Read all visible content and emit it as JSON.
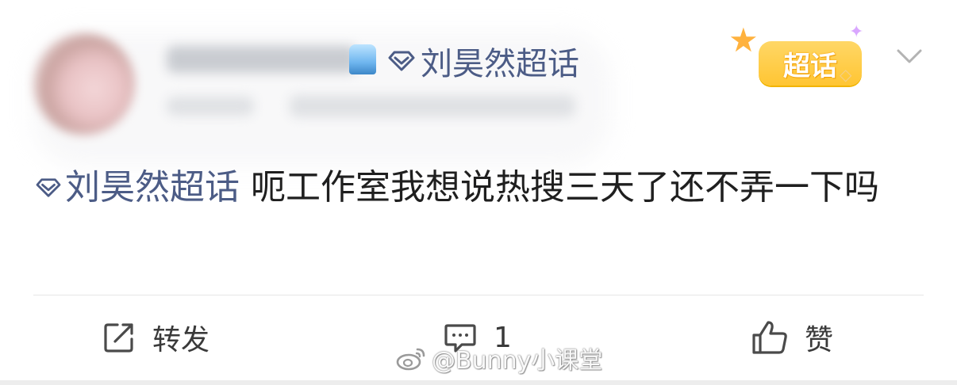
{
  "header": {
    "topic_name": "刘昊然超话",
    "super_topic_badge": "超话"
  },
  "post": {
    "topic_name": "刘昊然超话",
    "text": " 呃工作室我想说热搜三天了还不弄一下吗"
  },
  "actions": {
    "repost_label": "转发",
    "comment_count": "1",
    "like_label": "赞"
  },
  "watermark": {
    "text": "@Bunny小课堂"
  },
  "icons": {
    "topic": "diamond-icon",
    "menu": "chevron-down-icon",
    "repost": "share-icon",
    "comment": "comment-icon",
    "like": "thumbs-up-icon",
    "watermark": "weibo-logo-icon"
  },
  "colors": {
    "topic_link": "#4c5c86",
    "badge": "#ffc533"
  }
}
